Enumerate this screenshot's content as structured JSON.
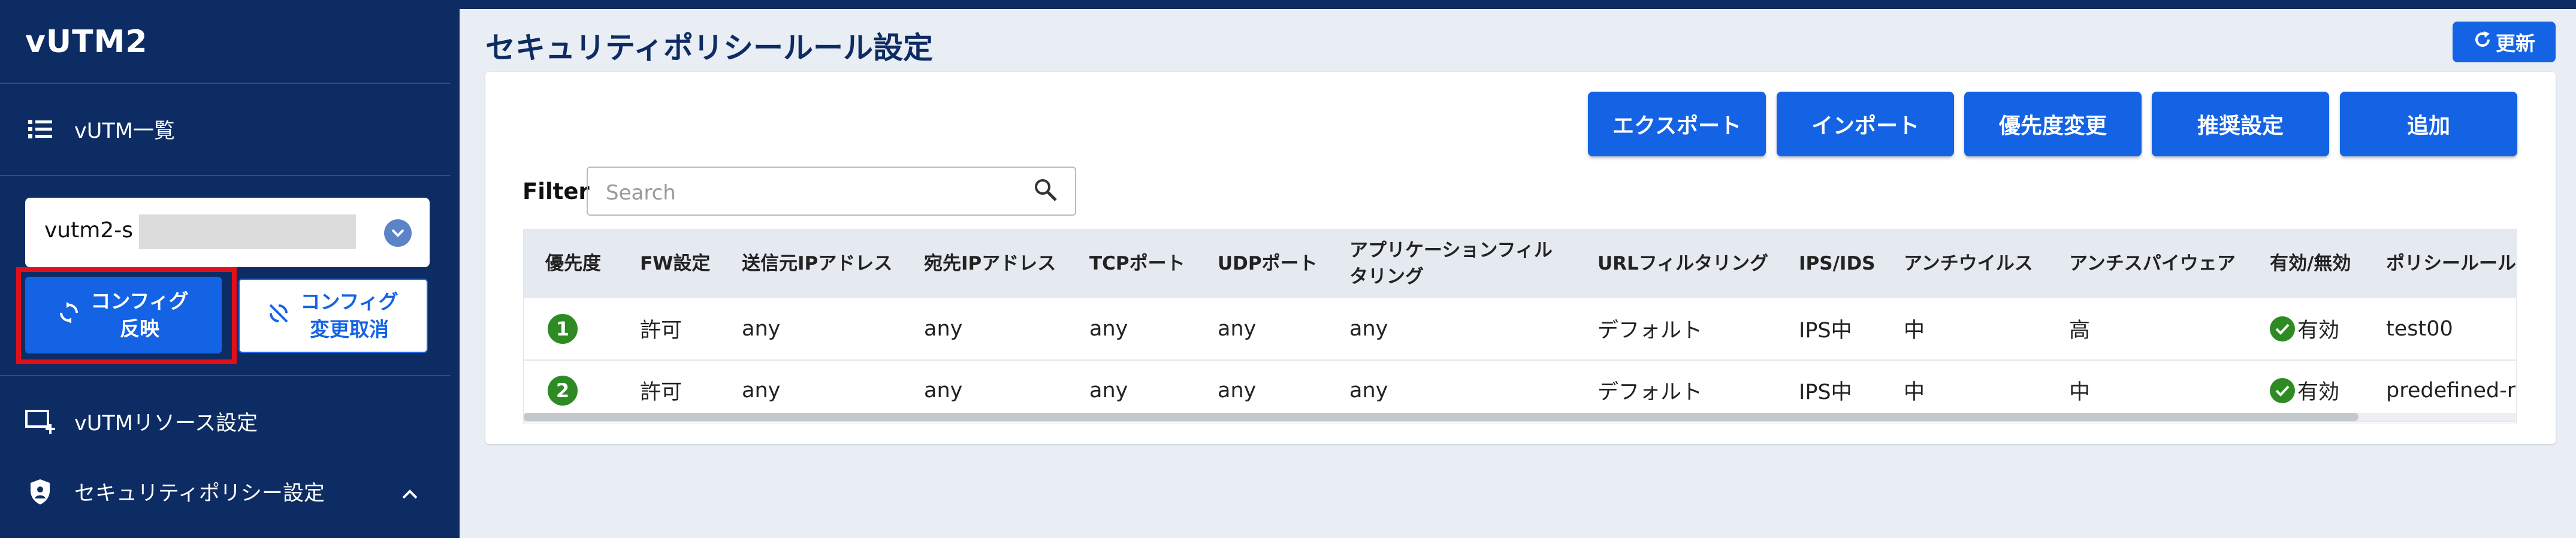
{
  "app": {
    "title": "vUTM2"
  },
  "sidebar": {
    "vutm_list": "vUTM一覧",
    "selected_vutm": "vutm2-s",
    "apply_line1": "コンフィグ",
    "apply_line2": "反映",
    "cancel_line1": "コンフィグ",
    "cancel_line2": "変更取消",
    "resource_settings": "vUTMリソース設定",
    "security_policy": "セキュリティポリシー設定"
  },
  "header": {
    "title": "セキュリティポリシールール設定",
    "refresh": "更新"
  },
  "actions": {
    "export": "エクスポート",
    "import": "インポート",
    "priority_change": "優先度変更",
    "recommended": "推奨設定",
    "add": "追加"
  },
  "filter": {
    "label": "Filter",
    "placeholder": "Search"
  },
  "table": {
    "headers": [
      "優先度",
      "FW設定",
      "送信元IPアドレス",
      "宛先IPアドレス",
      "TCPポート",
      "UDPポート",
      "アプリケーションフィル\nタリング",
      "URLフィルタリング",
      "IPS/IDS",
      "アンチウイルス",
      "アンチスパイウェア",
      "有効/無効",
      "ポリシールール名"
    ],
    "rows": [
      {
        "priority": "1",
        "fw": "許可",
        "src": "any",
        "dst": "any",
        "tcp": "any",
        "udp": "any",
        "app": "any",
        "url": "デフォルト",
        "ips": "IPS中",
        "av": "中",
        "as": "高",
        "enabled": "有効",
        "name": "test00"
      },
      {
        "priority": "2",
        "fw": "許可",
        "src": "any",
        "dst": "any",
        "tcp": "any",
        "udp": "any",
        "app": "any",
        "url": "デフォルト",
        "ips": "IPS中",
        "av": "中",
        "as": "中",
        "enabled": "有効",
        "name": "predefined-re"
      }
    ]
  },
  "colors": {
    "sidebar_bg": "#0d2c63",
    "primary": "#1463e4",
    "highlight_border": "#e0101a",
    "success": "#2e8b24"
  }
}
